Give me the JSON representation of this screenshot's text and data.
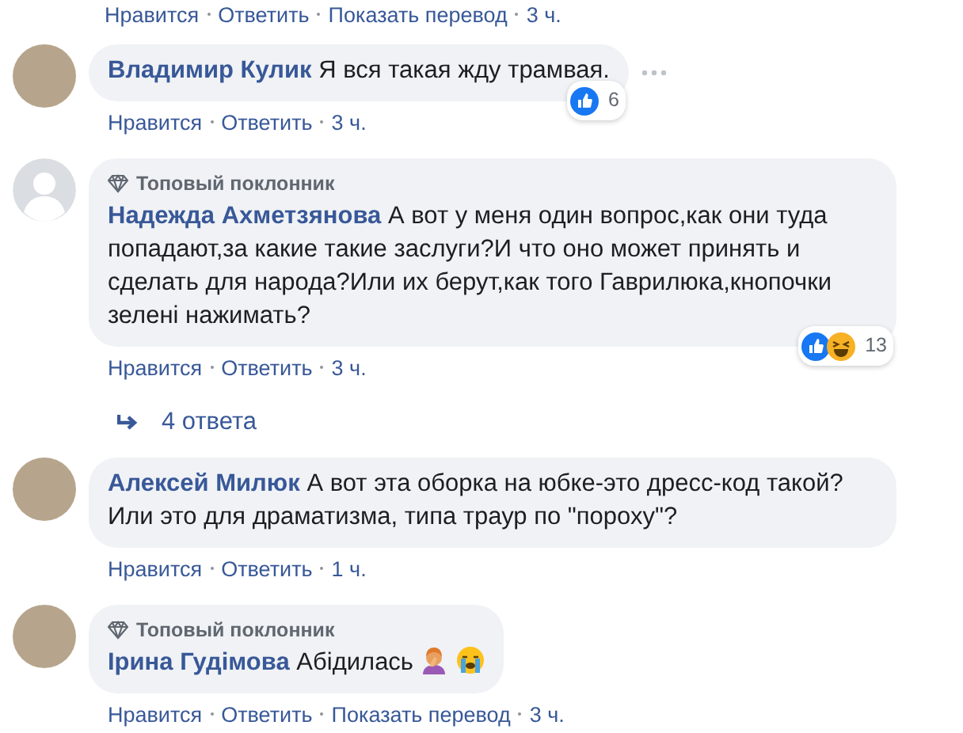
{
  "top_actions": {
    "actions": [
      "Нравится",
      "Ответить",
      "Показать перевод"
    ],
    "time": "3 ч."
  },
  "comments": [
    {
      "avatar": {
        "kind": "photo"
      },
      "author": "Владимир Кулик",
      "text": "Я вся такая жду трамвая.",
      "actions": [
        "Нравится",
        "Ответить"
      ],
      "time": "3 ч.",
      "reactions": {
        "types": [
          {
            "kind": "like"
          }
        ],
        "count": "6"
      },
      "more_menu": true
    },
    {
      "avatar": {
        "kind": "default"
      },
      "badge": "Топовый поклонник",
      "author": "Надежда Ахметзянова",
      "text": "А вот у меня один вопрос,как они туда попадают,за какие такие заслуги?И что оно может принять и сделать для народа?Или их берут,как того Гаврилюка,кнопочки зелені нажимать?",
      "actions": [
        "Нравится",
        "Ответить"
      ],
      "time": "3 ч.",
      "reactions": {
        "types": [
          {
            "kind": "like"
          },
          {
            "kind": "haha"
          }
        ],
        "count": "13"
      },
      "replies": "4 ответа"
    },
    {
      "avatar": {
        "kind": "photo"
      },
      "author": "Алексей Милюк",
      "text": "А вот эта оборка на юбке-это дресс-код такой? Или это для драматизма, типа траур по \"пороху\"?",
      "actions": [
        "Нравится",
        "Ответить"
      ],
      "time": "1 ч."
    },
    {
      "avatar": {
        "kind": "photo"
      },
      "badge": "Топовый поклонник",
      "author": "Ірина Гудімова",
      "text": "Абідилась",
      "emoji": [
        {
          "kind": "facepalm"
        },
        {
          "kind": "crying"
        }
      ],
      "actions": [
        "Нравится",
        "Ответить",
        "Показать перевод"
      ],
      "time": "3 ч."
    }
  ]
}
